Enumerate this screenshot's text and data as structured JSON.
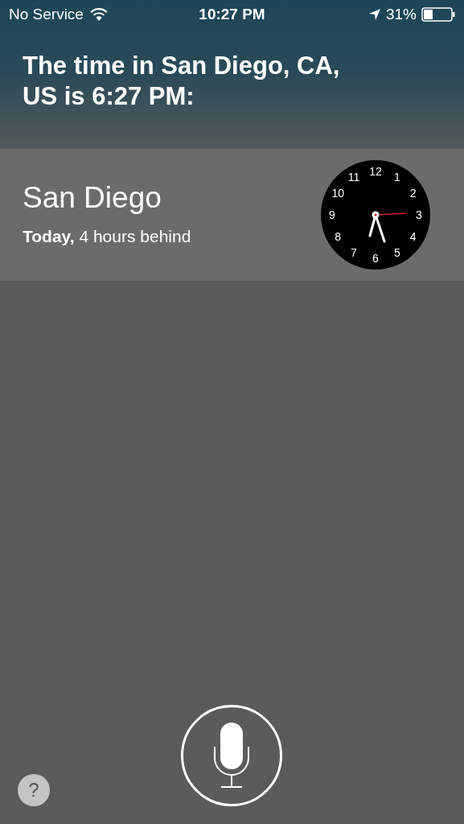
{
  "status_bar": {
    "carrier": "No Service",
    "time": "10:27 PM",
    "battery": "31%"
  },
  "answer": {
    "text": "The time in San Diego, CA, US is 6:27 PM:"
  },
  "clock_card": {
    "city": "San Diego",
    "detail": "**Today,** 4 hours behind",
    "numerals": [
      "12",
      "1",
      "2",
      "3",
      "4",
      "5",
      "6",
      "7",
      "8",
      "9",
      "10",
      "11"
    ]
  },
  "help_button": {
    "label": "?"
  }
}
